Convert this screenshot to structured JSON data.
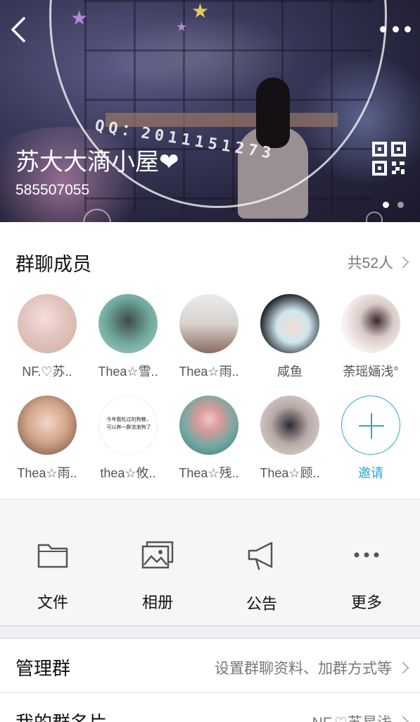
{
  "header": {
    "group_name": "苏大大滴小屋❤",
    "group_number": "585507055",
    "overlay_text": "QQ：2011151273"
  },
  "members": {
    "title": "群聊成员",
    "count_label": "共52人",
    "list": [
      {
        "name": "NF.♡苏.."
      },
      {
        "name": "Thea☆雪.."
      },
      {
        "name": "Thea☆雨.."
      },
      {
        "name": "咸鱼"
      },
      {
        "name": "荼瑶婳浅°"
      },
      {
        "name": "Thea☆雨.."
      },
      {
        "name": "thea☆攸.."
      },
      {
        "name": "Thea☆残.."
      },
      {
        "name": "Thea☆顾.."
      }
    ],
    "avatar_text_line1": "今年我吃过的狗粮，",
    "avatar_text_line2": "可以养一群流浪狗了",
    "invite_label": "邀请"
  },
  "tools": {
    "items": [
      {
        "label": "文件",
        "icon": "folder-icon"
      },
      {
        "label": "相册",
        "icon": "photo-album-icon"
      },
      {
        "label": "公告",
        "icon": "megaphone-icon"
      },
      {
        "label": "更多",
        "icon": "more-dots-icon"
      }
    ]
  },
  "settings": {
    "rows": [
      {
        "label": "管理群",
        "value": "设置群聊资料、加群方式等"
      },
      {
        "label": "我的群名片",
        "value": "NF.♡苏星浅"
      }
    ]
  },
  "colors": {
    "accent": "#2fa4d8",
    "text_primary": "#111111",
    "text_secondary": "#777777",
    "background": "#f5f6f8"
  }
}
